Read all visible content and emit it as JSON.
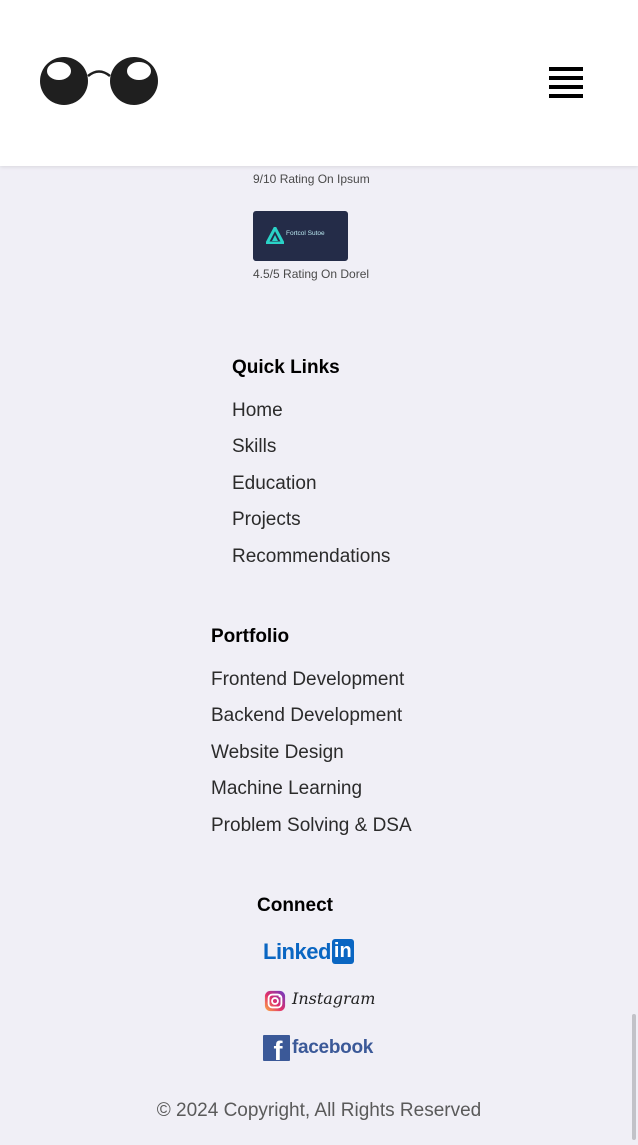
{
  "ratings": [
    {
      "caption": "9/10 Rating On Ipsum"
    },
    {
      "logo_text": "Fortcol Sutoe",
      "caption": "4.5/5 Rating On Dorel"
    }
  ],
  "quick_links": {
    "title": "Quick Links",
    "items": [
      "Home",
      "Skills",
      "Education",
      "Projects",
      "Recommendations"
    ]
  },
  "portfolio": {
    "title": "Portfolio",
    "items": [
      "Frontend Development",
      "Backend Development",
      "Website Design",
      "Machine Learning",
      "Problem Solving & DSA"
    ]
  },
  "connect": {
    "title": "Connect",
    "linkedin": {
      "text": "Linked",
      "box": "in"
    },
    "instagram": {
      "text": "Instagram"
    },
    "facebook": {
      "text": "facebook",
      "glyph": "f"
    }
  },
  "footer": {
    "copyright": "© 2024 Copyright, All Rights Reserved"
  },
  "colors": {
    "page_bg": "#f0eff6",
    "linkedin": "#0a66c2",
    "facebook": "#3b5998",
    "badge_bg": "#242c48"
  }
}
